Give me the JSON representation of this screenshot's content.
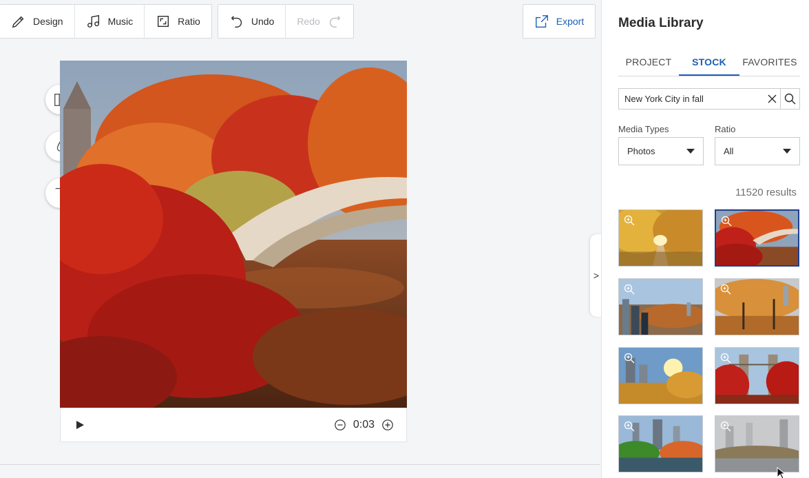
{
  "toolbar": {
    "design_label": "Design",
    "music_label": "Music",
    "ratio_label": "Ratio",
    "undo_label": "Undo",
    "redo_label": "Redo",
    "export_label": "Export"
  },
  "player": {
    "time": "0:03"
  },
  "panel": {
    "title": "Media Library",
    "tabs": [
      {
        "label": "PROJECT",
        "active": false
      },
      {
        "label": "STOCK",
        "active": true
      },
      {
        "label": "FAVORITES",
        "active": false
      }
    ],
    "search": {
      "value": "New York City in fall"
    },
    "media_types": {
      "label": "Media Types",
      "value": "Photos"
    },
    "ratio": {
      "label": "Ratio",
      "value": "All"
    },
    "results": "11520 results",
    "thumbnails_selected_index": 1
  },
  "colors": {
    "accent": "#1b5fb5",
    "selected_border": "#1d3e8f"
  }
}
